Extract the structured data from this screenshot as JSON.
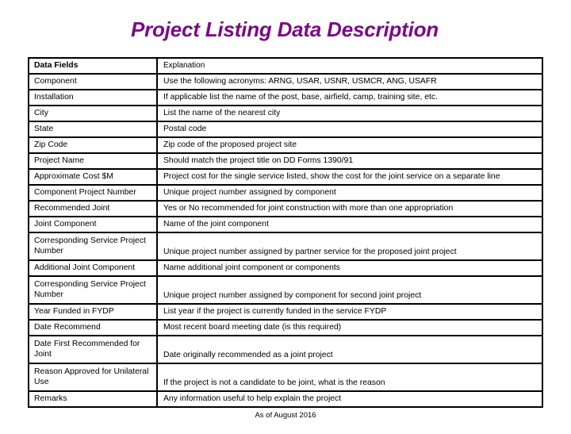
{
  "title": "Project Listing Data Description",
  "colors": {
    "title": "#7b0a87",
    "border": "#000000"
  },
  "table": {
    "headers": {
      "field": "Data Fields",
      "explanation": "Explanation"
    },
    "rows": [
      {
        "field": "Component",
        "explanation": "Use the following acronyms: ARNG, USAR, USNR, USMCR, ANG, USAFR"
      },
      {
        "field": "Installation",
        "explanation": "If applicable list the name of the post, base, airfield, camp, training site, etc."
      },
      {
        "field": "City",
        "explanation": "List the name of the nearest city"
      },
      {
        "field": "State",
        "explanation": "Postal code"
      },
      {
        "field": "Zip Code",
        "explanation": "Zip code of the proposed project site"
      },
      {
        "field": "Project Name",
        "explanation": "Should match the project title on DD Forms 1390/91"
      },
      {
        "field": "Approximate Cost $M",
        "explanation": "Project cost for the single service listed, show the cost for the joint service on a separate line"
      },
      {
        "field": "Component Project Number",
        "explanation": "Unique project number assigned by component"
      },
      {
        "field": "Recommended Joint",
        "explanation": "Yes or No recommended for joint construction with more than one appropriation"
      },
      {
        "field": "Joint Component",
        "explanation": "Name of the joint component"
      },
      {
        "field": "Corresponding Service Project Number",
        "explanation": "Unique project number assigned by partner service for the proposed joint project"
      },
      {
        "field": "Additional Joint Component",
        "explanation": "Name additional joint component or components"
      },
      {
        "field": "Corresponding Service Project Number",
        "explanation": "Unique project number assigned by component for second joint project"
      },
      {
        "field": "Year Funded in FYDP",
        "explanation": "List year if the project is currently funded in the service FYDP"
      },
      {
        "field": "Date Recommend",
        "explanation": "Most recent board meeting date (is this required)"
      },
      {
        "field": "Date First Recommended for Joint",
        "explanation": "Date originally recommended as a joint project"
      },
      {
        "field": "Reason Approved for Unilateral Use",
        "explanation": "If the project is not a candidate to be joint, what is the reason"
      },
      {
        "field": "Remarks",
        "explanation": "Any information useful to help explain the project"
      }
    ]
  },
  "footer": "As of August 2016"
}
